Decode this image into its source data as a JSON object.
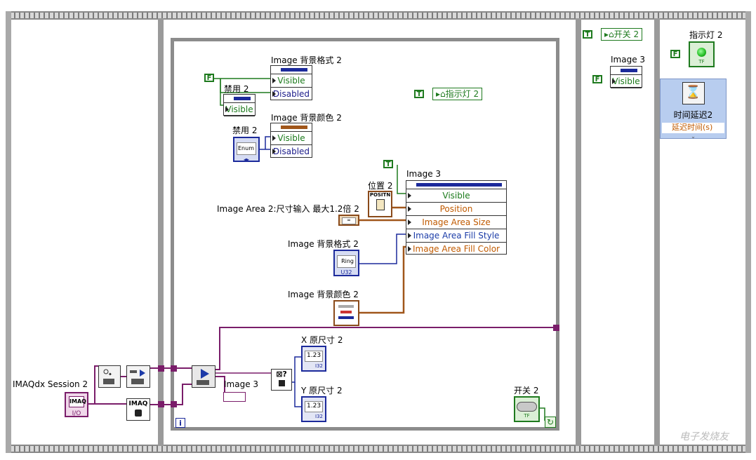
{
  "left_panel": {
    "session_label": "IMAQdx Session 2",
    "session_icon": "IMAQ",
    "session_sub": "I/O",
    "imaq_node": "IMAQ"
  },
  "while_loop": {
    "iteration_terminal": "i",
    "constants": {
      "false1": "F",
      "true1": "T",
      "true2": "T"
    },
    "disable_label": "禁用 2",
    "disable_label_b": "禁用 2",
    "disable_visible": "Visible",
    "enum_text": "Enum",
    "bg_format_label": "Image 背景格式 2",
    "bg_format_props": [
      "Visible",
      "Disabled"
    ],
    "bg_color_label": "Image 背景颜色 2",
    "bg_color_props": [
      "Visible",
      "Disabled"
    ],
    "indicator_local": "指示灯 2",
    "position_label": "位置 2",
    "position_icon": "POSITN",
    "image3_label": "Image 3",
    "image3_props": [
      "Visible",
      "Position",
      "Image Area Size",
      "Image Area Fill Style",
      "Image Area Fill Color"
    ],
    "area_label": "Image Area 2:尺寸输入  最大1.2倍 2",
    "area_ctrl": "∞",
    "bg_format_ctrl_label": "Image 背景格式 2",
    "ring_text": "Ring",
    "ring_sub": "U32",
    "bg_color_ctrl_label": "Image 背景颜色 2",
    "image3_bottom_label": "Image 3",
    "x_label": "X 原尺寸 2",
    "y_label": "Y 原尺寸 2",
    "num_text": "1.23",
    "num_sub": "I32",
    "switch_label": "开关 2",
    "switch_sub": "TF",
    "select_q": "?"
  },
  "middle_panel": {
    "true_const": "T",
    "switch_local": "开关 2",
    "image3_label": "Image 3",
    "false_const": "F",
    "visible": "Visible"
  },
  "right_panel": {
    "indicator_label": "指示灯 2",
    "false_const": "F",
    "indicator_sub": "TF",
    "delay_title": "时间延迟2",
    "delay_input": "延迟时间(s)"
  },
  "watermark": "电子发烧友"
}
